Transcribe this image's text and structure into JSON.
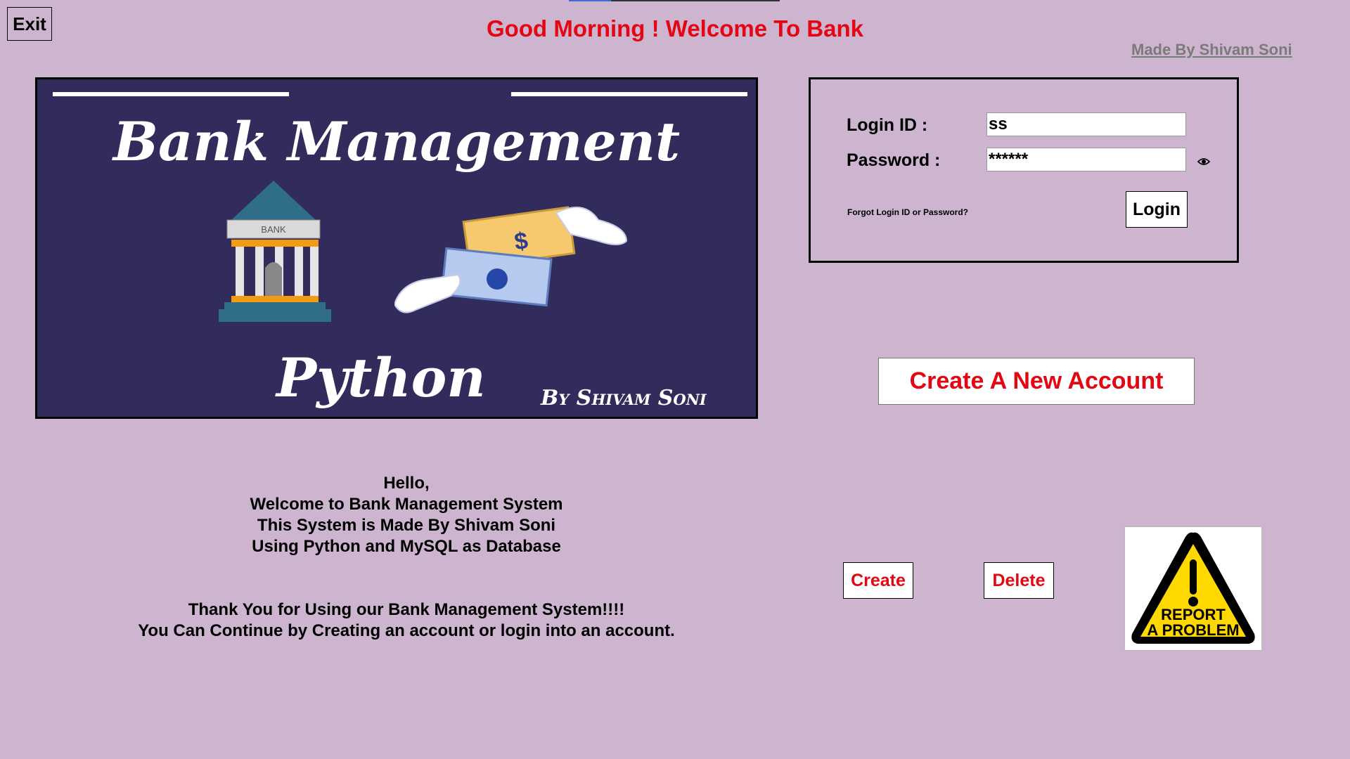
{
  "header": {
    "exit_label": "Exit",
    "greeting": "Good Morning ! Welcome To Bank",
    "made_by": "Made By Shivam Soni"
  },
  "banner": {
    "title": "Bank Management",
    "subtitle": "Python",
    "by_line": "By Shivam Soni",
    "bank_sign": "BANK",
    "colors": {
      "background": "#312c5b"
    }
  },
  "login": {
    "id_label": "Login ID :",
    "id_value": "ss",
    "password_label": "Password :",
    "password_value": "******",
    "forgot_link": "Forgot Login ID or Password?",
    "login_label": "Login",
    "show_password_icon": "eye-icon"
  },
  "create_account_label": "Create A New Account",
  "welcome_lines": [
    "Hello,",
    "Welcome to Bank Management System",
    "This System is Made By Shivam Soni",
    "Using Python and MySQL as Database"
  ],
  "thanks_lines": [
    "Thank You for Using our Bank Management System!!!!",
    "You Can Continue by Creating an account or login into an account."
  ],
  "bottom": {
    "create_label": "Create",
    "delete_label": "Delete",
    "report_line1": "REPORT",
    "report_line2": "A PROBLEM"
  },
  "colors": {
    "page_background": "#cdb5cf",
    "accent_red": "#e30613"
  }
}
